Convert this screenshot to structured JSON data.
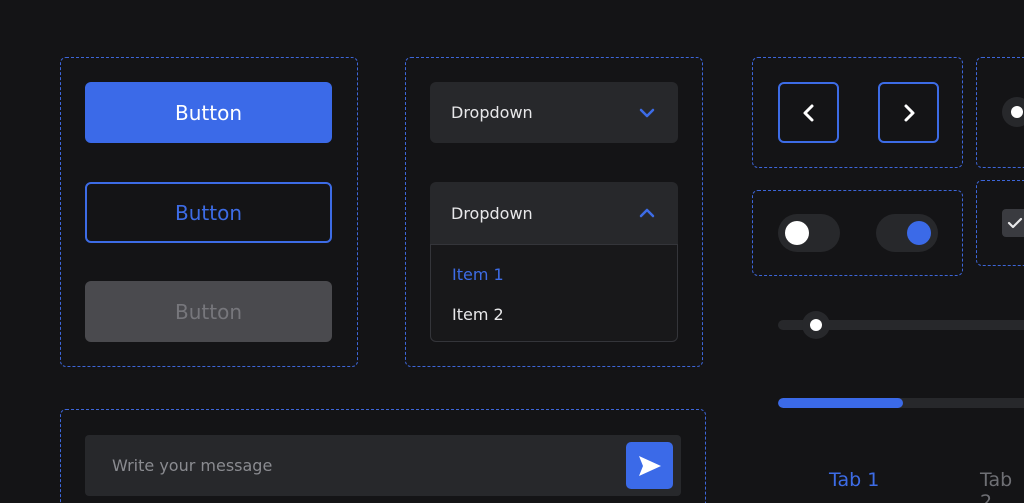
{
  "buttons": {
    "primary_label": "Button",
    "outline_label": "Button",
    "disabled_label": "Button"
  },
  "dropdowns": {
    "closed_label": "Dropdown",
    "open_label": "Dropdown",
    "options": [
      "Item 1",
      "Item 2"
    ],
    "selected_option": "Item 1"
  },
  "toggles": [
    {
      "state": "off",
      "knob_color": "#ffffff"
    },
    {
      "state": "on",
      "knob_color": "#3b6ae8"
    }
  ],
  "slider": {
    "value_fraction": 0.1
  },
  "progress": {
    "value_fraction": 0.51
  },
  "tabs": [
    {
      "label": "Tab 1",
      "active": true
    },
    {
      "label": "Tab 2",
      "active": false
    }
  ],
  "message": {
    "placeholder": "Write your message",
    "value": ""
  },
  "icons": {
    "prev": "chevron-left-icon",
    "next": "chevron-right-icon",
    "send": "send-icon",
    "dropdown_closed": "chevron-down-icon",
    "dropdown_open": "chevron-up-icon",
    "check": "check-icon"
  },
  "colors": {
    "background": "#141416",
    "accent": "#3b6ae8",
    "surface": "#27282b",
    "disabled": "#4a4a4e",
    "frame_dash": "#3d66d9"
  }
}
